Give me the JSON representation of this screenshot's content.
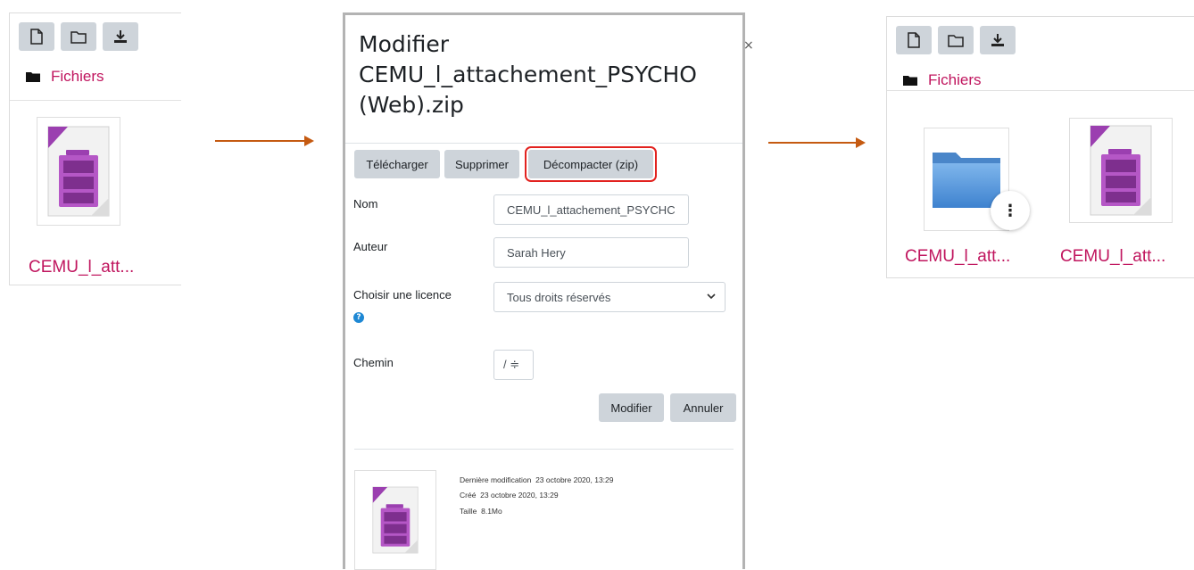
{
  "left_panel": {
    "toolbar": {
      "new_file_icon": "file-icon",
      "new_folder_icon": "folder-icon",
      "download_icon": "download-icon"
    },
    "path_label": "Fichiers",
    "file": {
      "name": "CEMU_l_att...",
      "icon": "zip-archive-icon"
    }
  },
  "dialog": {
    "title_line1": "Modifier",
    "title_line2": "CEMU_l_attachement_PSYCHO",
    "title_line3": "(Web).zip",
    "close_label": "×",
    "actions": {
      "download": "Télécharger",
      "delete": "Supprimer",
      "unzip": "Décompacter (zip)"
    },
    "form": {
      "name_label": "Nom",
      "name_value": "CEMU_l_attachement_PSYCHC",
      "author_label": "Auteur",
      "author_value": "Sarah Hery",
      "license_label": "Choisir une licence",
      "license_value": "Tous droits réservés",
      "help_glyph": "?",
      "path_label": "Chemin",
      "path_value": "/ ≑"
    },
    "buttons": {
      "update": "Modifier",
      "cancel": "Annuler"
    },
    "meta": {
      "last_modified_label": "Dernière modification",
      "last_modified_value": "23 octobre 2020, 13:29",
      "created_label": "Créé",
      "created_value": "23 octobre 2020, 13:29",
      "size_label": "Taille",
      "size_value": "8.1Mo"
    }
  },
  "right_panel": {
    "path_label": "Fichiers",
    "files": [
      {
        "name": "CEMU_l_att...",
        "icon": "folder-icon",
        "menu_glyph": "⋮"
      },
      {
        "name": "CEMU_l_att...",
        "icon": "zip-archive-icon"
      }
    ]
  },
  "colors": {
    "link": "#c0155e",
    "arrow": "#c55a11",
    "highlight": "#e2221f",
    "button_bg": "#ced4da",
    "zip_purple": "#9b3fb0",
    "folder_blue": "#4a90d9"
  }
}
